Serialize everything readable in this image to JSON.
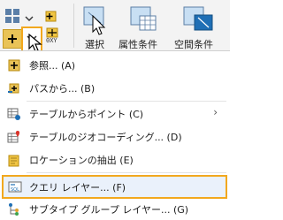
{
  "ribbon": {
    "select_label": "選択",
    "attr_label": "属性条件",
    "spatial_label": "空間条件",
    "xy_label": "0XY"
  },
  "menu": {
    "items": [
      {
        "label": "参照... (A)"
      },
      {
        "label": "パスから... (B)"
      },
      {
        "label": "テーブルからポイント (C)"
      },
      {
        "label": "テーブルのジオコーディング... (D)"
      },
      {
        "label": "ロケーションの抽出 (E)"
      },
      {
        "label": "クエリ レイヤー... (F)"
      },
      {
        "label": "サブタイプ グループ レイヤー... (G)"
      }
    ],
    "submenu_arrow": "›"
  },
  "colors": {
    "highlight_border": "#f2a81e",
    "add_icon": "#e9b52b",
    "blue_icon": "#1f6fb5"
  }
}
